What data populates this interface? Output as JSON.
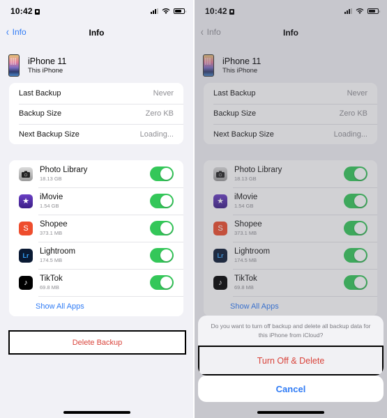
{
  "status_bar": {
    "time": "10:42"
  },
  "nav": {
    "back_label": "Info",
    "title": "Info"
  },
  "device": {
    "name": "iPhone 11",
    "subtitle": "This iPhone"
  },
  "backup_info": [
    {
      "label": "Last Backup",
      "value": "Never"
    },
    {
      "label": "Backup Size",
      "value": "Zero KB"
    },
    {
      "label": "Next Backup Size",
      "value": "Loading..."
    }
  ],
  "apps": [
    {
      "name": "Photo Library",
      "size": "18.13 GB",
      "icon": "camera-icon",
      "enabled": true
    },
    {
      "name": "iMovie",
      "size": "1.54 GB",
      "icon": "imovie-star-icon",
      "enabled": true
    },
    {
      "name": "Shopee",
      "size": "373.1 MB",
      "icon": "shopee-bag-icon",
      "enabled": true
    },
    {
      "name": "Lightroom",
      "size": "174.5 MB",
      "icon": "lightroom-icon",
      "enabled": true
    },
    {
      "name": "TikTok",
      "size": "69.8 MB",
      "icon": "tiktok-note-icon",
      "enabled": true
    }
  ],
  "show_all_label": "Show All Apps",
  "delete_label": "Delete Backup",
  "action_sheet": {
    "message": "Do you want to turn off backup and delete all backup data for this iPhone from iCloud?",
    "destructive_label": "Turn Off & Delete",
    "cancel_label": "Cancel"
  },
  "glyphs": {
    "lightroom": "Lr",
    "shopee": "S",
    "imovie": "★",
    "tiktok": "♪",
    "back_chevron": "‹"
  },
  "colors": {
    "accent": "#2f7bf5",
    "destructive": "#d9433a",
    "toggle_on": "#34c759"
  }
}
